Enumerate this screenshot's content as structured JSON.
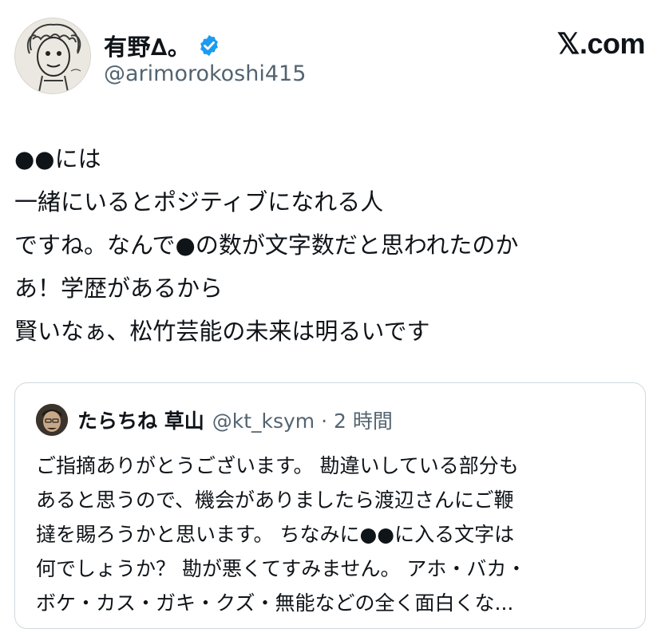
{
  "author": {
    "display_name": "有野∆。",
    "handle": "@arimorokoshi415",
    "verified": true,
    "avatar": "sketch-portrait-avatar"
  },
  "brand": {
    "logo_text": "𝕏.com"
  },
  "tweet": {
    "lines": [
      "●●には",
      "一緒にいるとポジティブになれる人",
      "ですね。なんで●の数が文字数だと思われたのか",
      "あ！学歴があるから",
      "賢いなぁ、松竹芸能の未来は明るいです"
    ]
  },
  "quote": {
    "display_name": "たらちね 草山",
    "handle_time": "@kt_ksym · 2 時間",
    "lines": [
      "ご指摘ありがとうございます。 勘違いしている部分も",
      "あると思うので、機会がありましたら渡辺さんにご鞭",
      "撻を賜ろうかと思います。 ちなみに●●に入る文字は",
      "何でしょうか？ 勘が悪くてすみません。 アホ・バカ・",
      "ボケ・カス・ガキ・クズ・無能などの全く面白くな..."
    ]
  },
  "colors": {
    "text": "#0f1419",
    "secondary": "#536471",
    "verified_blue": "#1d9bf0",
    "border": "#cfd9de"
  }
}
